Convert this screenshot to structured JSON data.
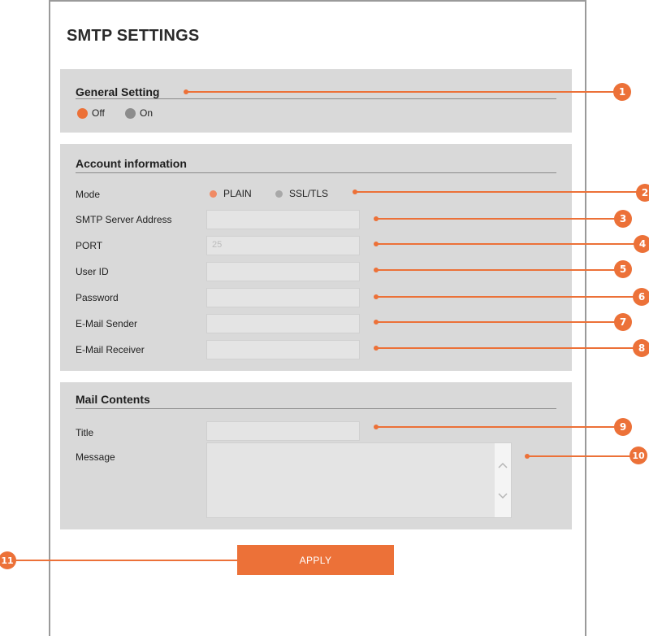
{
  "page": {
    "title": "SMTP SETTINGS"
  },
  "general": {
    "heading": "General Setting",
    "options": [
      {
        "label": "Off",
        "selected": true
      },
      {
        "label": "On",
        "selected": false
      }
    ]
  },
  "account": {
    "heading": "Account information",
    "mode": {
      "label": "Mode",
      "options": [
        {
          "label": "PLAIN",
          "selected": true
        },
        {
          "label": "SSL/TLS",
          "selected": false
        }
      ]
    },
    "fields": [
      {
        "label": "SMTP Server Address",
        "value": ""
      },
      {
        "label": "PORT",
        "value": "25"
      },
      {
        "label": "User ID",
        "value": ""
      },
      {
        "label": "Password",
        "value": ""
      },
      {
        "label": "E-Mail Sender",
        "value": ""
      },
      {
        "label": "E-Mail Receiver",
        "value": ""
      }
    ]
  },
  "mail": {
    "heading": "Mail Contents",
    "title_label": "Title",
    "title_value": "",
    "message_label": "Message",
    "message_value": ""
  },
  "apply_label": "APPLY",
  "callouts": [
    "1",
    "2",
    "3",
    "4",
    "5",
    "6",
    "7",
    "8",
    "9",
    "10",
    "11"
  ],
  "colors": {
    "accent": "#ec7138",
    "panel_bg": "#d9d9d9",
    "radio_selected": "#ec7138",
    "radio_unselected": "#8c8c8c",
    "radio_small_selected": "#f08a64",
    "radio_small_unselected": "#a8a8a8"
  }
}
